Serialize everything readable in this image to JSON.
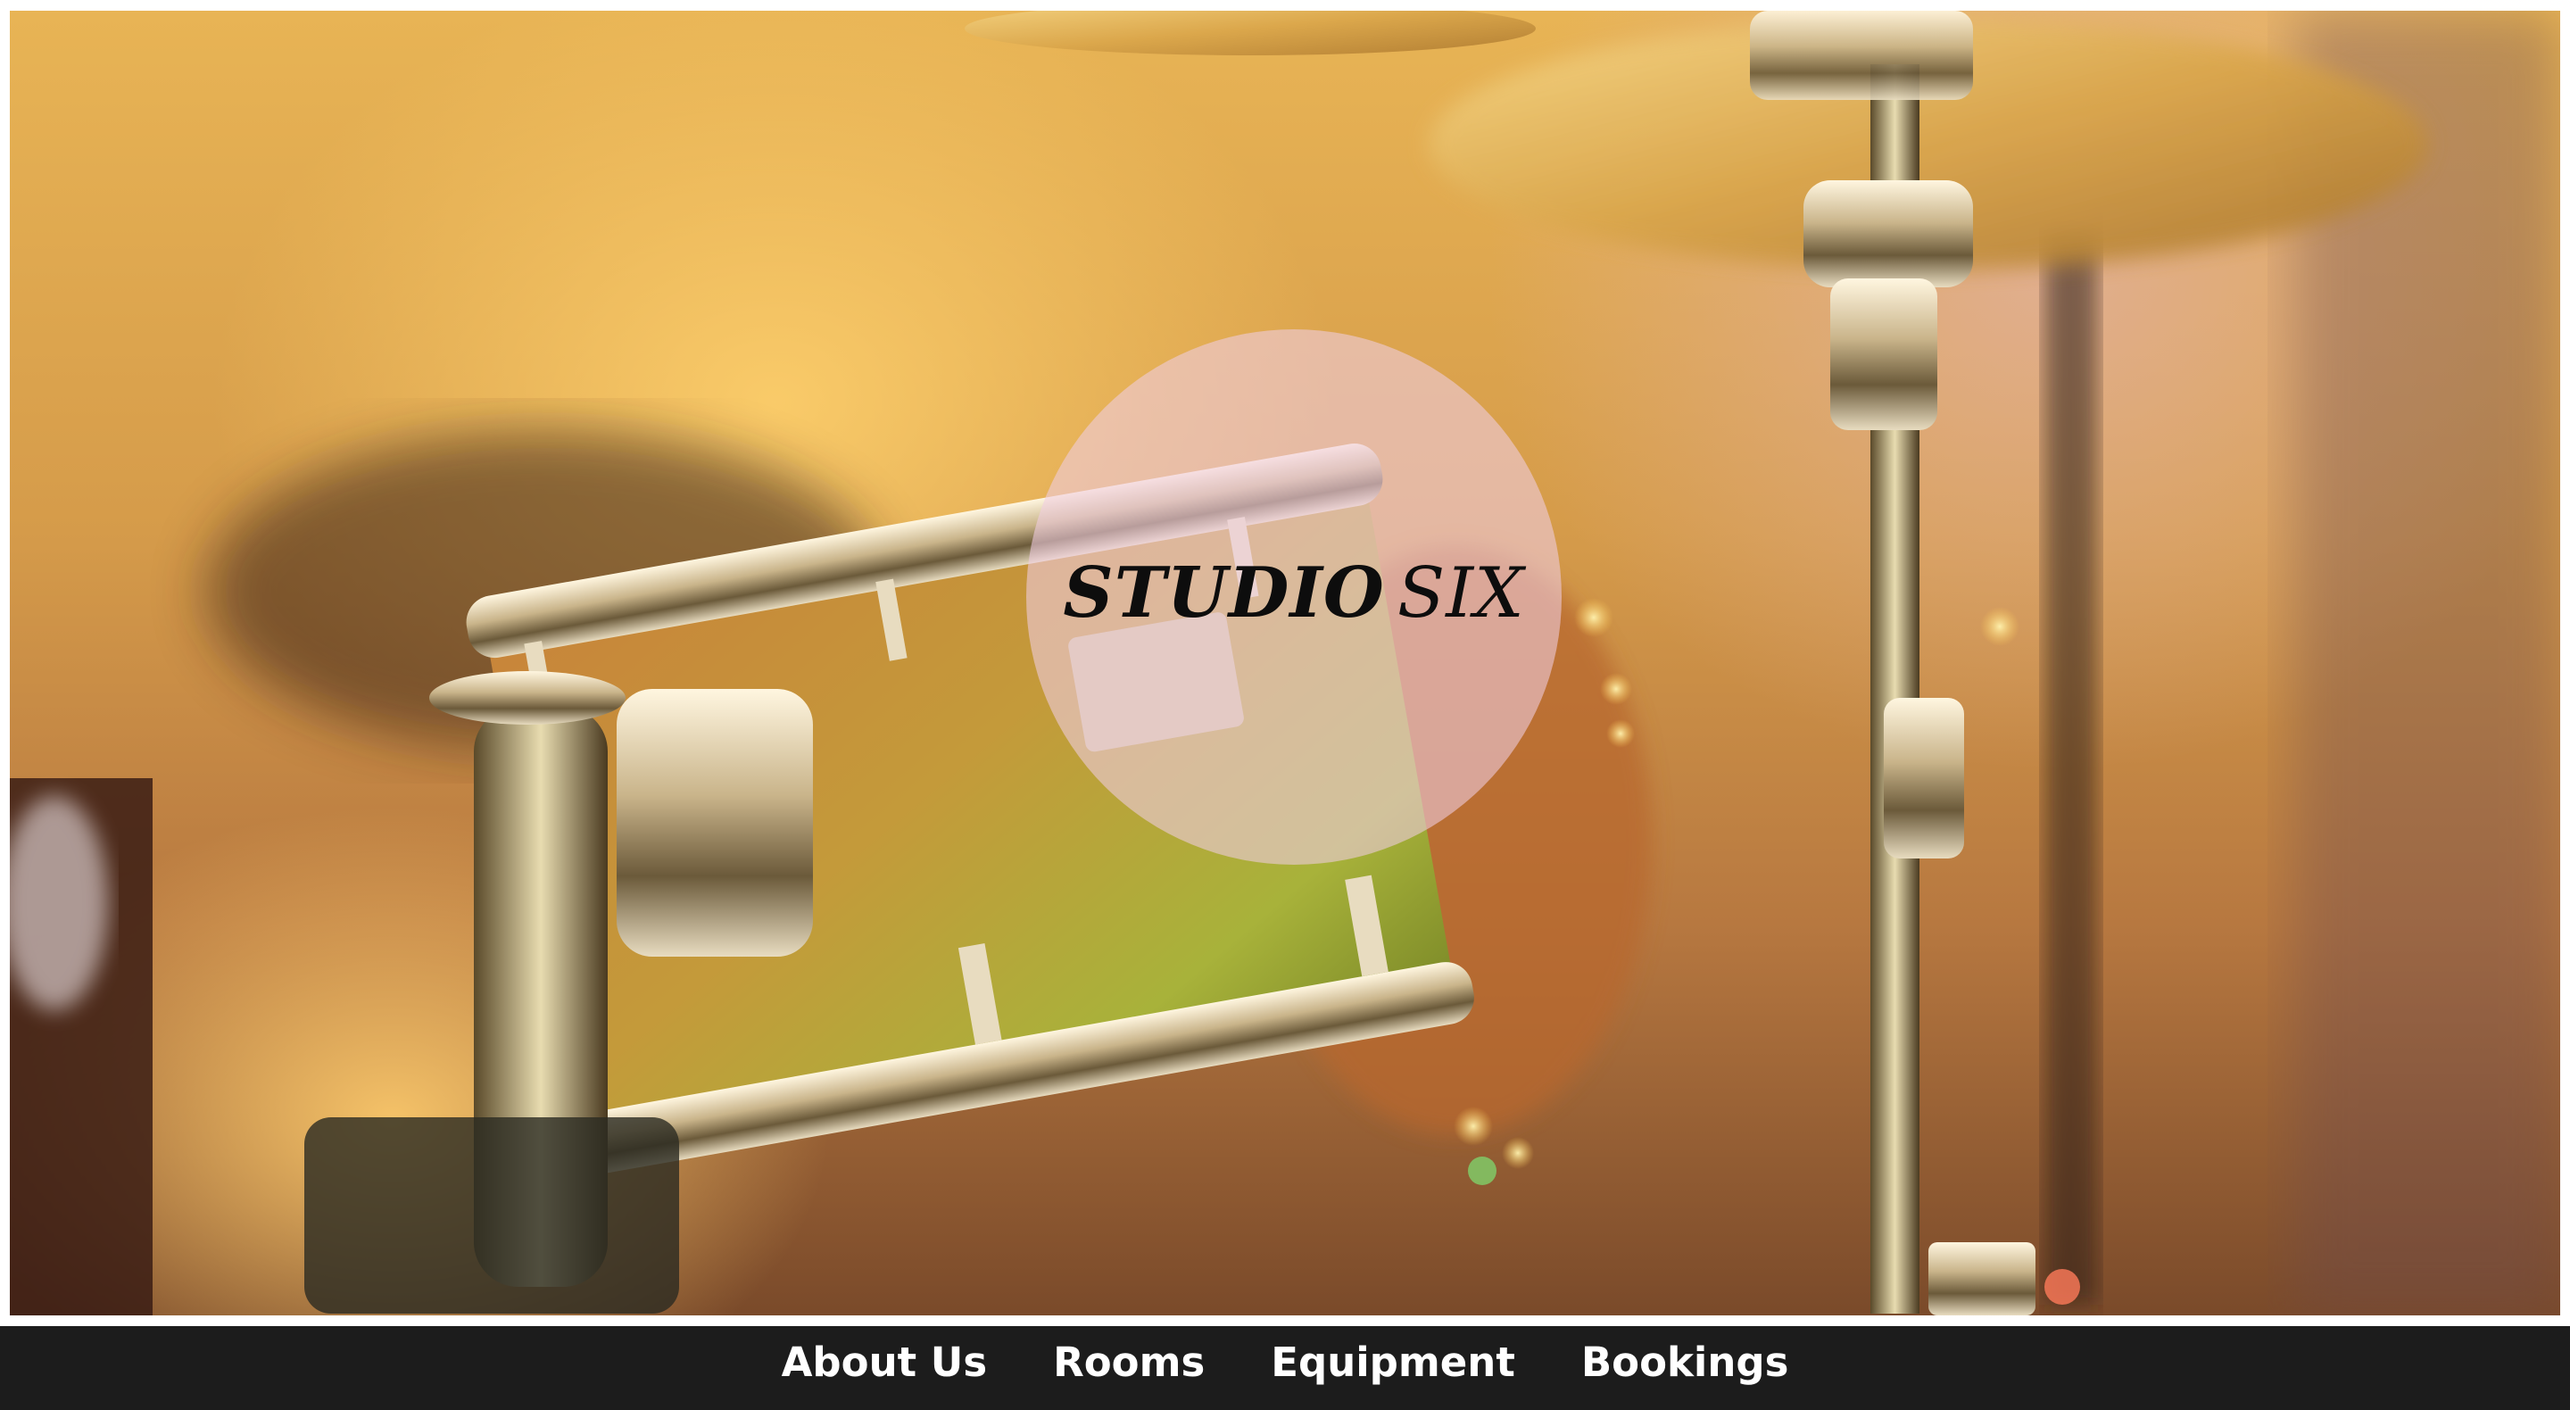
{
  "logo": {
    "word1": "STUDIO",
    "word2": "SIX"
  },
  "nav": {
    "items": [
      {
        "label": "About Us"
      },
      {
        "label": "Rooms"
      },
      {
        "label": "Equipment"
      },
      {
        "label": "Bookings"
      }
    ]
  },
  "colors": {
    "navbar_bg": "#1c1c1c",
    "nav_text": "#ffffff",
    "badge_fill": "#f0cde1"
  },
  "hero": {
    "image_subject": "drum-kit-photo"
  }
}
